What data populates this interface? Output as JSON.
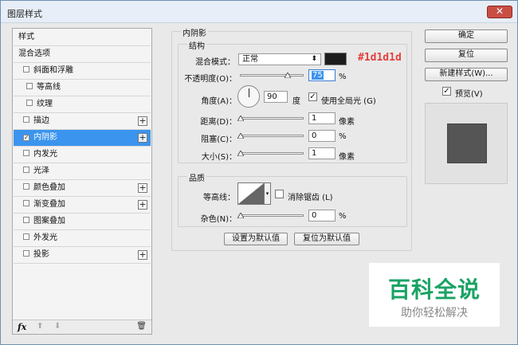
{
  "window": {
    "title": "图层样式",
    "close_glyph": "✕"
  },
  "styles_panel": {
    "items": [
      {
        "label": "样式",
        "checkbox": false,
        "checked": false,
        "plus": false,
        "selected": false
      },
      {
        "label": "混合选项",
        "checkbox": false,
        "checked": false,
        "plus": false,
        "selected": false
      },
      {
        "label": "斜面和浮雕",
        "checkbox": true,
        "checked": false,
        "plus": false,
        "selected": false
      },
      {
        "label": "等高线",
        "checkbox": true,
        "checked": false,
        "plus": false,
        "selected": false
      },
      {
        "label": "纹理",
        "checkbox": true,
        "checked": false,
        "plus": false,
        "selected": false
      },
      {
        "label": "描边",
        "checkbox": true,
        "checked": false,
        "plus": true,
        "selected": false
      },
      {
        "label": "内阴影",
        "checkbox": true,
        "checked": true,
        "plus": true,
        "selected": true
      },
      {
        "label": "内发光",
        "checkbox": true,
        "checked": false,
        "plus": false,
        "selected": false
      },
      {
        "label": "光泽",
        "checkbox": true,
        "checked": false,
        "plus": false,
        "selected": false
      },
      {
        "label": "颜色叠加",
        "checkbox": true,
        "checked": false,
        "plus": true,
        "selected": false
      },
      {
        "label": "渐变叠加",
        "checkbox": true,
        "checked": false,
        "plus": true,
        "selected": false
      },
      {
        "label": "图案叠加",
        "checkbox": true,
        "checked": false,
        "plus": false,
        "selected": false
      },
      {
        "label": "外发光",
        "checkbox": true,
        "checked": false,
        "plus": false,
        "selected": false
      },
      {
        "label": "投影",
        "checkbox": true,
        "checked": false,
        "plus": true,
        "selected": false
      }
    ],
    "footer": {
      "fx": "fx",
      "up": "⬆",
      "down": "⬇",
      "trash": "🗑"
    }
  },
  "inner_shadow": {
    "section_title": "内阴影",
    "structure": {
      "title": "结构",
      "blend_mode_label": "混合模式：",
      "blend_mode_value": "正常",
      "color": "#1d1d1d",
      "opacity_label": "不透明度(O)：",
      "opacity_value": "75",
      "opacity_unit": "%",
      "angle_label": "角度(A)：",
      "angle_value": "90",
      "angle_unit": "度",
      "global_light_label": "使用全局光 (G)",
      "global_light_checked": true,
      "distance_label": "距离(D)：",
      "distance_value": "1",
      "distance_unit": "像素",
      "choke_label": "阻塞(C)：",
      "choke_value": "0",
      "choke_unit": "%",
      "size_label": "大小(S)：",
      "size_value": "1",
      "size_unit": "像素"
    },
    "quality": {
      "title": "品质",
      "contour_label": "等高线：",
      "antialias_label": "消除锯齿 (L)",
      "noise_label": "杂色(N)：",
      "noise_value": "0",
      "noise_unit": "%"
    },
    "make_default": "设置为默认值",
    "reset_default": "复位为默认值"
  },
  "actions": {
    "ok": "确定",
    "reset": "复位",
    "new_style": "新建样式(W)...",
    "preview_label": "预览(V)",
    "preview_checked": true
  },
  "annotation": {
    "hex": "#1d1d1d"
  },
  "watermark": {
    "title": "百科全说",
    "subtitle": "助你轻松解决"
  }
}
